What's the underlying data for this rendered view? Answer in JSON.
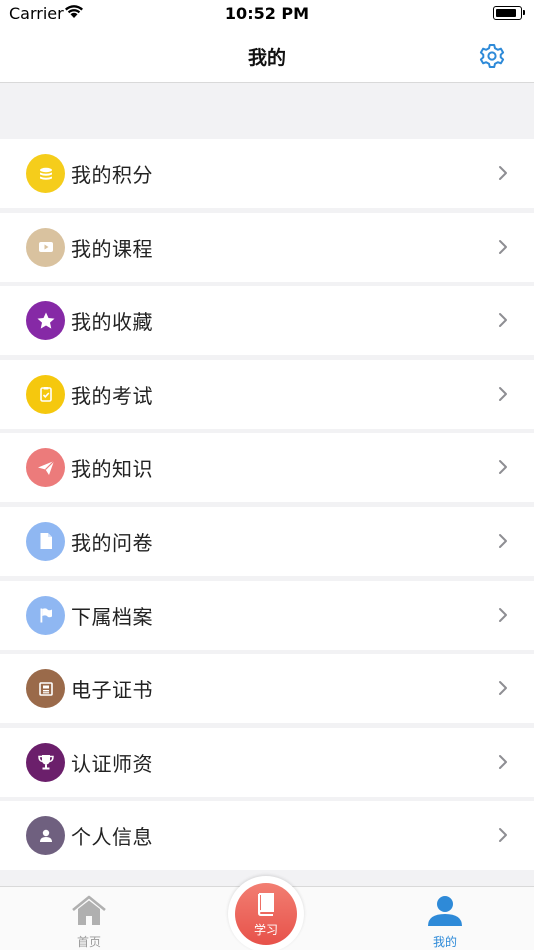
{
  "status_bar": {
    "carrier": "Carrier",
    "time": "10:52 PM"
  },
  "nav": {
    "title": "我的",
    "settings_icon": "gear-icon"
  },
  "menu": [
    {
      "label": "我的积分",
      "icon": "coins-icon",
      "color": "#f5cd1b"
    },
    {
      "label": "我的课程",
      "icon": "video-play-icon",
      "color": "#d9c29f"
    },
    {
      "label": "我的收藏",
      "icon": "star-icon",
      "color": "#8629a6"
    },
    {
      "label": "我的考试",
      "icon": "clipboard-check-icon",
      "color": "#f5c80e"
    },
    {
      "label": "我的知识",
      "icon": "paper-plane-icon",
      "color": "#ec7b7b"
    },
    {
      "label": "我的问卷",
      "icon": "document-icon",
      "color": "#8fb7f2"
    },
    {
      "label": "下属档案",
      "icon": "flag-icon",
      "color": "#8fb7f2"
    },
    {
      "label": "电子证书",
      "icon": "certificate-icon",
      "color": "#9a6a4a"
    },
    {
      "label": "认证师资",
      "icon": "trophy-icon",
      "color": "#6b1f6b"
    },
    {
      "label": "个人信息",
      "icon": "user-icon",
      "color": "#6f607f"
    }
  ],
  "tabs": {
    "home": {
      "label": "首页",
      "icon": "home-icon"
    },
    "study": {
      "label": "学习",
      "icon": "book-icon"
    },
    "mine": {
      "label": "我的",
      "icon": "user-icon",
      "active": true
    }
  },
  "colors": {
    "accent": "#2e8ad8",
    "study_button": "#e95a50",
    "background": "#f2f2f4"
  }
}
